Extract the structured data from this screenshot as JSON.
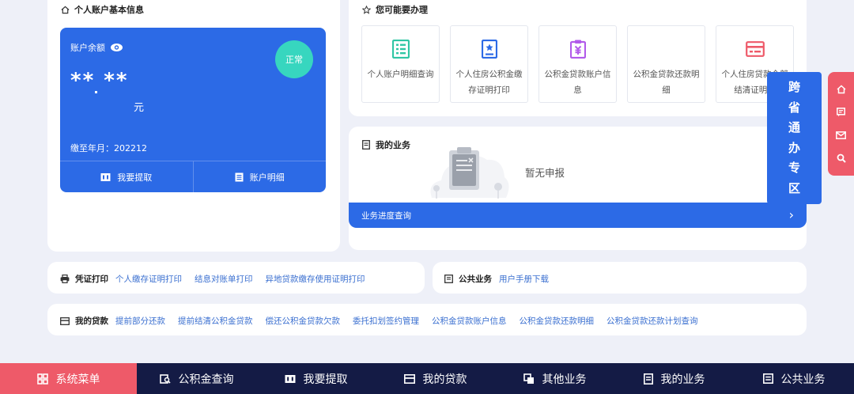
{
  "account_section": {
    "title": "个人账户基本信息",
    "balance_label": "账户余额",
    "balance_masked": "** **",
    "unit": "元",
    "paid_until": "缴至年月：202212",
    "status": "正常",
    "withdraw_label": "我要提取",
    "detail_label": "账户明细"
  },
  "services_section": {
    "title": "您可能要办理",
    "items": [
      {
        "label": "个人账户明细查询",
        "icon": "list-icon",
        "color": "#2fc6a4"
      },
      {
        "label": "个人住房公积金缴存证明打印",
        "icon": "certificate-icon",
        "color": "#2c6ae6"
      },
      {
        "label": "公积金贷款账户信息",
        "icon": "loan-doc-icon",
        "color": "#b25bea"
      },
      {
        "label": "公积金贷款还款明细",
        "icon": "payment-icon",
        "color": "#ffffff"
      },
      {
        "label": "个人住房贷款全部结清证明打",
        "icon": "card-icon",
        "color": "#ee5a69"
      }
    ]
  },
  "my_business": {
    "title": "我的业务",
    "empty_text": "暂无申报",
    "progress_label": "业务进度查询"
  },
  "cross_province": {
    "chars": [
      "跨",
      "省",
      "通",
      "办",
      "专",
      "区"
    ]
  },
  "float_icons": [
    "home-icon",
    "feedback-icon",
    "mail-icon",
    "search-icon"
  ],
  "certificate_print": {
    "label": "凭证打印",
    "links": [
      "个人缴存证明打印",
      "结息对账单打印",
      "异地贷款缴存使用证明打印"
    ]
  },
  "public_business": {
    "label": "公共业务",
    "links": [
      "用户手册下载"
    ]
  },
  "my_loans": {
    "label": "我的贷款",
    "links": [
      "提前部分还款",
      "提前结清公积金贷款",
      "偿还公积金贷款欠款",
      "委托扣划签约管理",
      "公积金贷款账户信息",
      "公积金贷款还款明细",
      "公积金贷款还款计划查询"
    ]
  },
  "bottom_nav": [
    {
      "label": "系统菜单",
      "icon": "grid-icon",
      "active": true
    },
    {
      "label": "公积金查询",
      "icon": "query-icon",
      "active": false
    },
    {
      "label": "我要提取",
      "icon": "withdraw-icon",
      "active": false
    },
    {
      "label": "我的贷款",
      "icon": "loan-icon",
      "active": false
    },
    {
      "label": "其他业务",
      "icon": "other-icon",
      "active": false
    },
    {
      "label": "我的业务",
      "icon": "business-icon",
      "active": false
    },
    {
      "label": "公共业务",
      "icon": "public-icon",
      "active": false
    }
  ],
  "colors": {
    "primary": "#2c6ae6",
    "accent_teal": "#37d6bf",
    "accent_red": "#ee5a69",
    "nav_dark": "#141b45",
    "page_bg": "#eef0f8"
  }
}
